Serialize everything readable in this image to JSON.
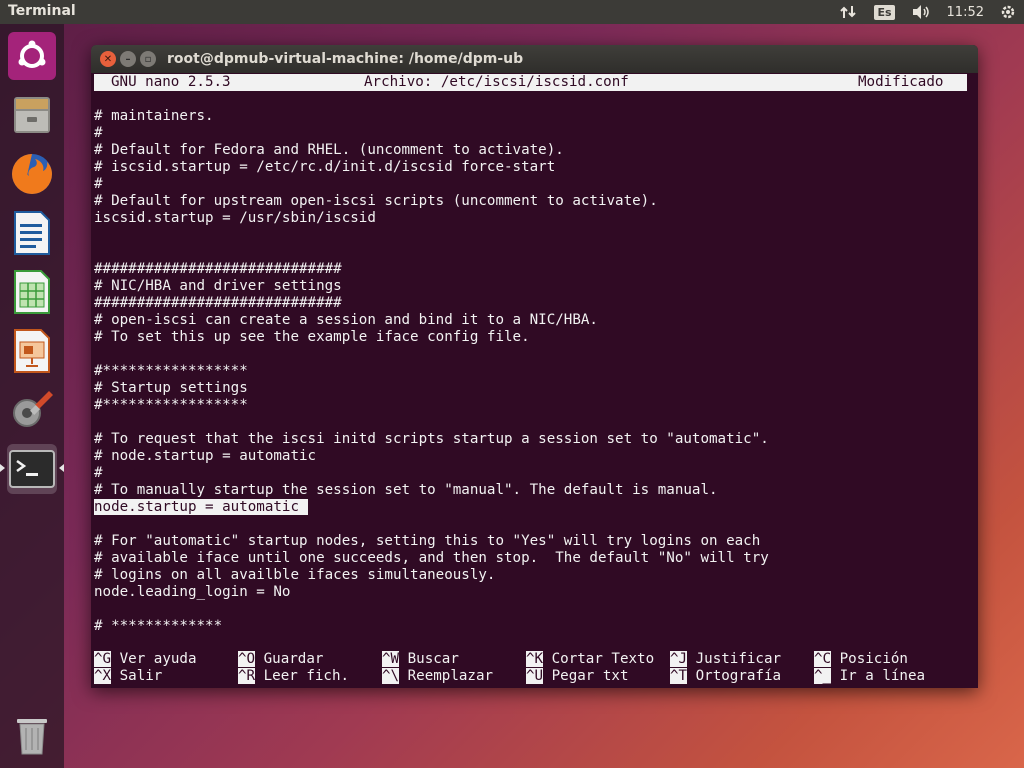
{
  "panel": {
    "app_name": "Terminal",
    "keyboard_layout": "Es",
    "clock": "11:52"
  },
  "launcher": {
    "items": [
      {
        "name": "ubuntu-dash",
        "icon": "ubuntu-logo-icon"
      },
      {
        "name": "files",
        "icon": "file-cabinet-icon"
      },
      {
        "name": "firefox",
        "icon": "firefox-icon"
      },
      {
        "name": "libreoffice-writer",
        "icon": "writer-doc-icon"
      },
      {
        "name": "libreoffice-calc",
        "icon": "calc-sheet-icon"
      },
      {
        "name": "libreoffice-impress",
        "icon": "impress-slide-icon"
      },
      {
        "name": "system-settings",
        "icon": "settings-tools-icon"
      },
      {
        "name": "terminal",
        "icon": "terminal-icon"
      },
      {
        "name": "trash",
        "icon": "trash-icon"
      }
    ]
  },
  "window": {
    "title": "root@dpmub-virtual-machine: /home/dpm-ub"
  },
  "nano": {
    "version": "GNU nano 2.5.3",
    "file_label": "Archivo: /etc/iscsi/iscsid.conf",
    "status": "Modificado",
    "lines": [
      "# maintainers.",
      "#",
      "# Default for Fedora and RHEL. (uncomment to activate).",
      "# iscsid.startup = /etc/rc.d/init.d/iscsid force-start",
      "#",
      "# Default for upstream open-iscsi scripts (uncomment to activate).",
      "iscsid.startup = /usr/sbin/iscsid",
      "",
      "",
      "#############################",
      "# NIC/HBA and driver settings",
      "#############################",
      "# open-iscsi can create a session and bind it to a NIC/HBA.",
      "# To set this up see the example iface config file.",
      "",
      "#*****************",
      "# Startup settings",
      "#*****************",
      "",
      "# To request that the iscsi initd scripts startup a session set to \"automatic\".",
      "# node.startup = automatic",
      "#",
      "# To manually startup the session set to \"manual\". The default is manual.",
      "node.startup = automatic ",
      "",
      "# For \"automatic\" startup nodes, setting this to \"Yes\" will try logins on each",
      "# available iface until one succeeds, and then stop.  The default \"No\" will try",
      "# logins on all availble ifaces simultaneously.",
      "node.leading_login = No",
      "",
      "# *************"
    ],
    "selected_line_index": 23,
    "shortcuts_row1": [
      {
        "key": "^G",
        "label": "Ver ayuda"
      },
      {
        "key": "^O",
        "label": "Guardar"
      },
      {
        "key": "^W",
        "label": "Buscar"
      },
      {
        "key": "^K",
        "label": "Cortar Texto"
      },
      {
        "key": "^J",
        "label": "Justificar"
      },
      {
        "key": "^C",
        "label": "Posición"
      }
    ],
    "shortcuts_row2": [
      {
        "key": "^X",
        "label": "Salir"
      },
      {
        "key": "^R",
        "label": "Leer fich."
      },
      {
        "key": "^\\",
        "label": "Reemplazar"
      },
      {
        "key": "^U",
        "label": "Pegar txt"
      },
      {
        "key": "^T",
        "label": "Ortografía"
      },
      {
        "key": "^_",
        "label": "Ir a línea"
      }
    ]
  }
}
